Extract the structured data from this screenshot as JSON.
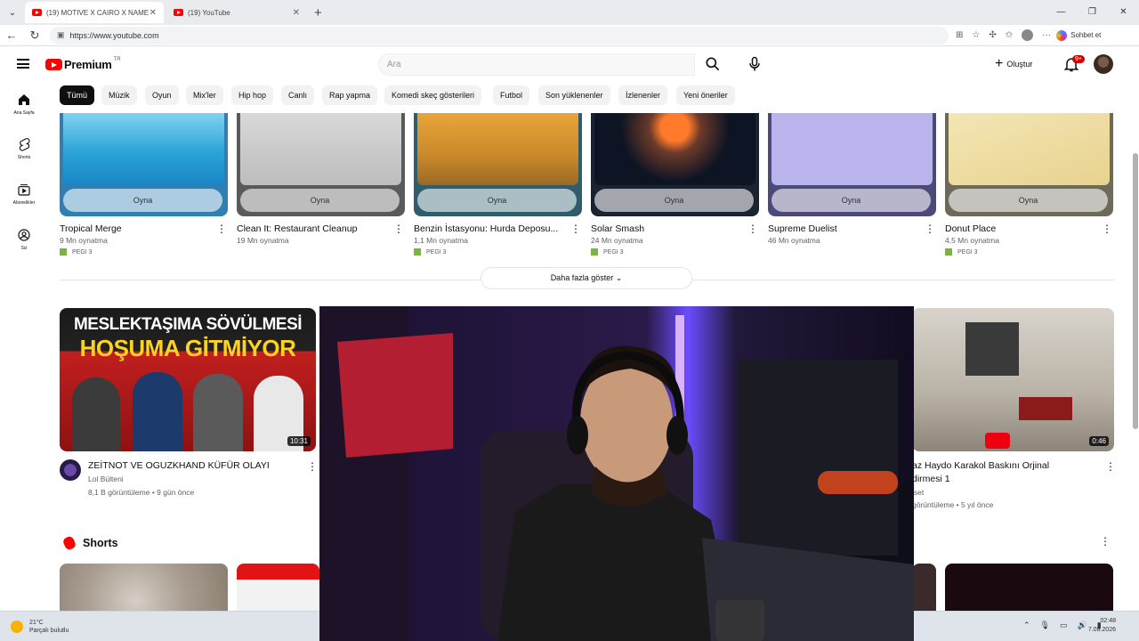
{
  "browser": {
    "tabs": [
      {
        "title": "(19) MOTIVE X CAIRO X NAME",
        "active": true
      },
      {
        "title": "(19) YouTube",
        "active": false
      }
    ],
    "url": "https://www.youtube.com",
    "copilot_label": "Sohbet et"
  },
  "youtube": {
    "logo_text": "Premium",
    "country_code": "TR",
    "search_placeholder": "Ara",
    "create_label": "Oluştur",
    "notification_count": "9+",
    "guide": [
      {
        "label": "Ana Sayfa",
        "icon": "home-icon"
      },
      {
        "label": "Shorts",
        "icon": "shorts-icon"
      },
      {
        "label": "Abonelikler",
        "icon": "subscriptions-icon"
      },
      {
        "label": "Siz",
        "icon": "you-icon"
      }
    ],
    "chips": [
      "Tümü",
      "Müzik",
      "Oyun",
      "Mix'ler",
      "Hip hop",
      "Canlı",
      "Rap yapma",
      "Komedi skeç gösterileri",
      "Futbol",
      "Son yüklenenler",
      "İzlenenler",
      "Yeni öneriler"
    ],
    "selected_chip": "Tümü",
    "games": [
      {
        "title": "Tropical Merge",
        "plays": "9 Mn oynatma",
        "pegi": "PEGI 3",
        "play_label": "Oyna"
      },
      {
        "title": "Clean It: Restaurant Cleanup",
        "plays": "19 Mn oynatma",
        "pegi": "",
        "play_label": "Oyna"
      },
      {
        "title": "Benzin İstasyonu: Hurda Deposu...",
        "plays": "1,1 Mn oynatma",
        "pegi": "PEGI 3",
        "play_label": "Oyna"
      },
      {
        "title": "Solar Smash",
        "plays": "24 Mn oynatma",
        "pegi": "PEGI 3",
        "play_label": "Oyna"
      },
      {
        "title": "Supreme Duelist",
        "plays": "46 Mn oynatma",
        "pegi": "",
        "play_label": "Oyna"
      },
      {
        "title": "Donut Place",
        "plays": "4,5 Mn oynatma",
        "pegi": "PEGI 3",
        "play_label": "Oyna"
      }
    ],
    "show_more_label": "Daha fazla göster",
    "videos": [
      {
        "thumb_line1": "MESLEKTAŞIMA SÖVÜLMESİ",
        "thumb_line2": "HOŞUMA GİTMİYOR",
        "duration": "10:31",
        "title": "ZEİTNOT VE OGUZKHAND KÜFÜR OLAYI",
        "channel": "Lol Bülteni",
        "meta": "8,1 B görüntüleme • 9 gün önce"
      },
      {
        "duration": "0:46",
        "title_line1": "az Haydo  Karakol Baskını Orjinal",
        "title_line2": "dirmesi 1",
        "channel": "lset",
        "meta": "görüntüleme • 5 yıl önce"
      }
    ],
    "shorts_label": "Shorts"
  },
  "taskbar": {
    "temperature": "21°C",
    "weather": "Parçalı bulutlu",
    "time": "02:48",
    "date": "7.08.2026"
  }
}
